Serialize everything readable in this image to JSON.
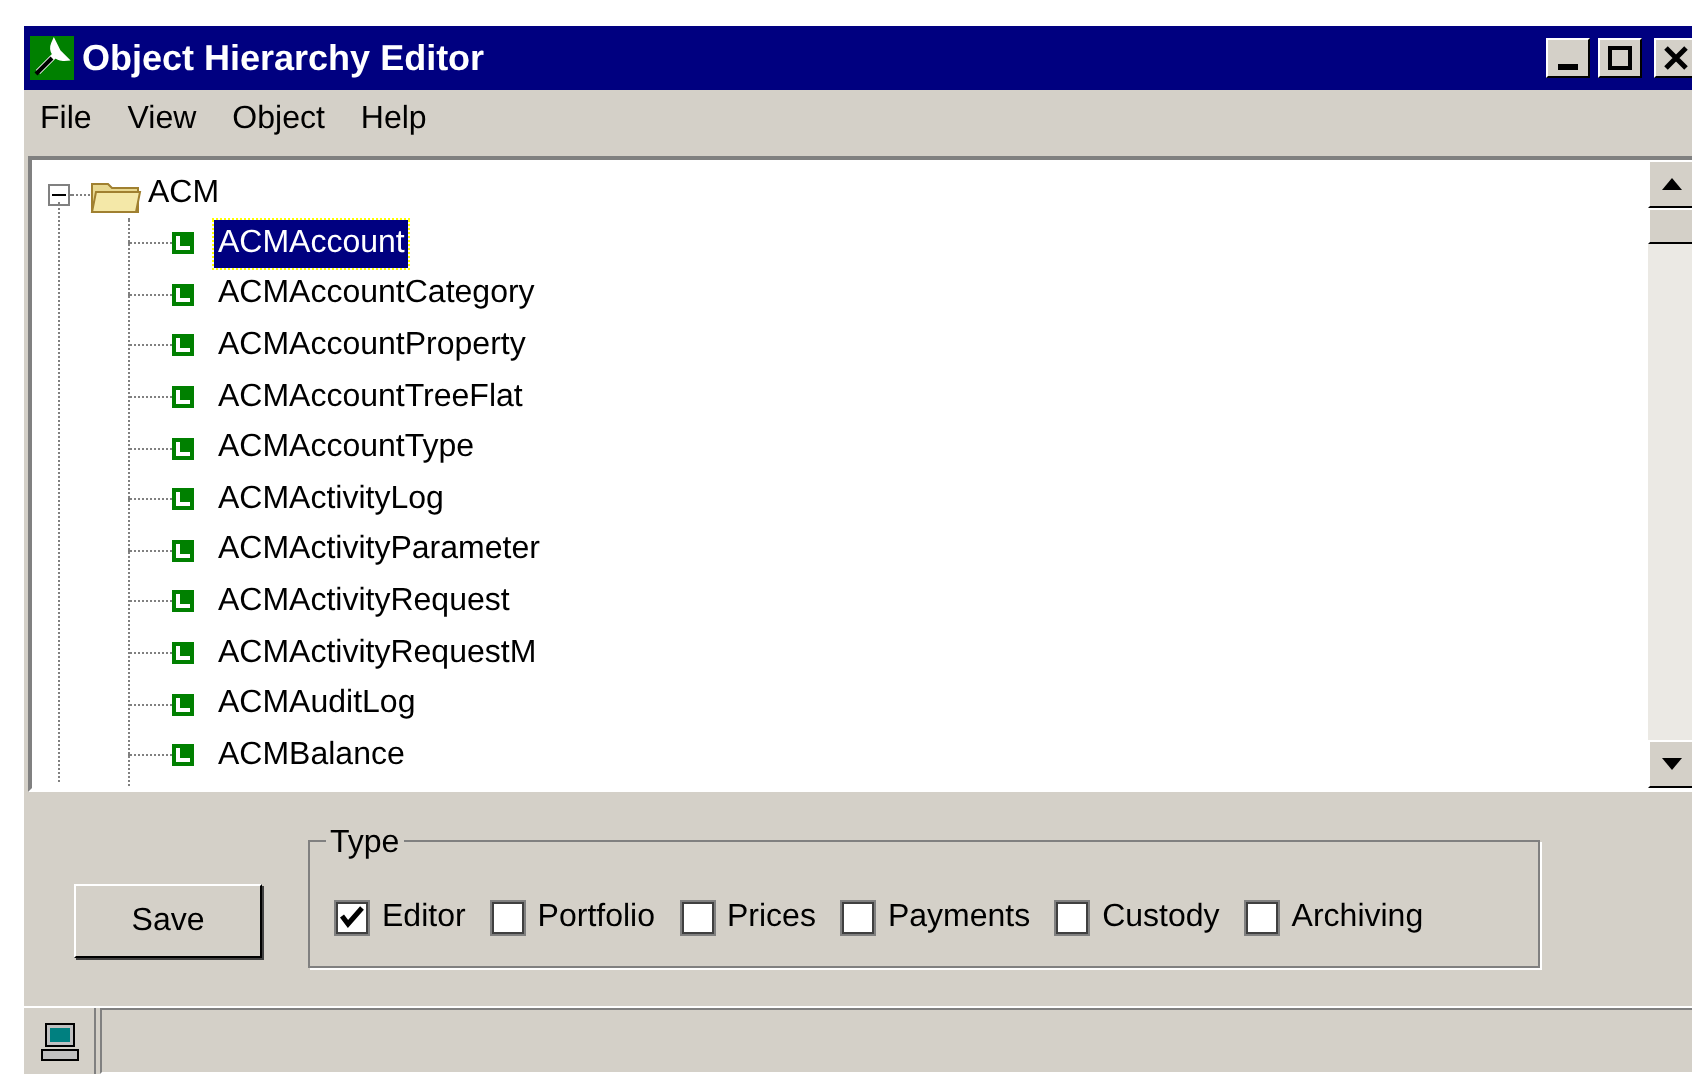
{
  "window": {
    "title": "Object Hierarchy Editor"
  },
  "menu": [
    "File",
    "View",
    "Object",
    "Help"
  ],
  "tree": [
    {
      "label": "ACM",
      "expanded": true,
      "children": [
        {
          "label": "ACMAccount",
          "selected": true
        },
        {
          "label": "ACMAccountCategory",
          "selected": false
        },
        {
          "label": "ACMAccountProperty",
          "selected": false
        },
        {
          "label": "ACMAccountTreeFlat",
          "selected": false
        },
        {
          "label": "ACMAccountType",
          "selected": false
        },
        {
          "label": "ACMActivityLog",
          "selected": false
        },
        {
          "label": "ACMActivityParameter",
          "selected": false
        },
        {
          "label": "ACMActivityRequest",
          "selected": false
        },
        {
          "label": "ACMActivityRequestM",
          "selected": false
        },
        {
          "label": "ACMAuditLog",
          "selected": false
        },
        {
          "label": "ACMBalance",
          "selected": false
        }
      ]
    }
  ],
  "save_button": "Save",
  "type_group": {
    "title": "Type",
    "options": [
      {
        "label": "Editor",
        "checked": true
      },
      {
        "label": "Portfolio",
        "checked": false
      },
      {
        "label": "Prices",
        "checked": false
      },
      {
        "label": "Payments",
        "checked": false
      },
      {
        "label": "Custody",
        "checked": false
      },
      {
        "label": "Archiving",
        "checked": false
      }
    ]
  }
}
